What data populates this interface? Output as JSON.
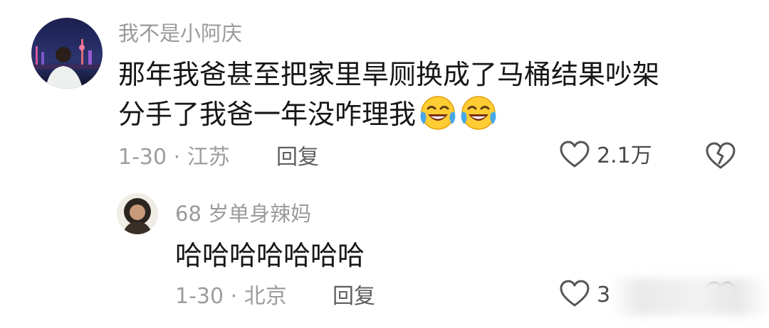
{
  "comments": [
    {
      "username": "我不是小阿庆",
      "text_line1": "那年我爸甚至把家里旱厕换成了马桶结果吵架",
      "text_line2": "分手了我爸一年没咋理我",
      "emojis": [
        "laughing-tears-emoji",
        "laughing-tears-emoji"
      ],
      "date_location": "1-30 · 江苏",
      "reply_label": "回复",
      "like_count": "2.1万"
    },
    {
      "username": "68 岁单身辣妈",
      "text": "哈哈哈哈哈哈哈",
      "date_location": "1-30 · 北京",
      "reply_label": "回复",
      "like_count": "3"
    }
  ],
  "icons": {
    "like": "heart-icon",
    "dislike": "broken-heart-icon"
  }
}
